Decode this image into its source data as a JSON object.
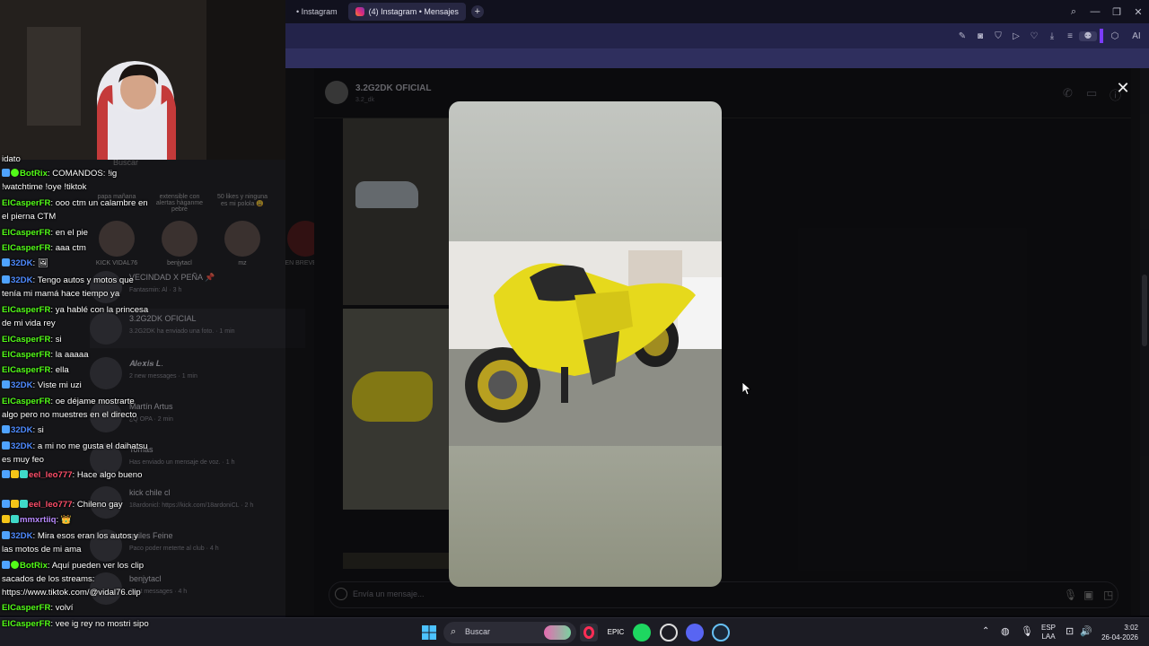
{
  "browser": {
    "tabs": [
      {
        "label": "• Instagram"
      },
      {
        "label": "(4) Instagram • Mensajes"
      }
    ],
    "new_tab": "+",
    "toolbar_ai": "AI"
  },
  "instagram": {
    "search_placeholder": "Buscar",
    "notes": [
      {
        "text": "",
        "name": "KICK VIDAL76"
      },
      {
        "text": "extensible con alertas hàganme pebre",
        "name": "benjytacl"
      },
      {
        "text": "50 likes y ninguna es mi polola 😩",
        "name": "mz"
      },
      {
        "text": "",
        "name": "EN BREVE MI"
      }
    ],
    "note_first_bubble": "papa mañana",
    "conversations": [
      {
        "title": "VECINDAD X PEÑA 📌",
        "sub": "Fantasmin: Al · 3 h"
      },
      {
        "title": "3.2G2DK OFICIAL",
        "sub": "3.2G2DK ha enviado una foto. · 1 min"
      },
      {
        "title": "𝑨𝒍𝒆𝒙𝒊𝒔 𝑳.",
        "sub": "2 new messages · 1 min"
      },
      {
        "title": "Martín Artus",
        "sub": "¿Q OPA · 2 min"
      },
      {
        "title": "Tomás",
        "sub": "Has enviado un mensaje de voz. · 1 h"
      },
      {
        "title": "kick chile cl",
        "sub": "18ardonicl: https://kick.com/18ardoniCL · 2 h"
      },
      {
        "title": "quiles Feine",
        "sub": "Paco poder meterte al club · 4 h"
      },
      {
        "title": "benjytacl",
        "sub": "Sent messages · 4 h"
      }
    ],
    "thread": {
      "name": "3.2G2DK OFICIAL",
      "username": "3.2_dk",
      "message_placeholder": "Envía un mensaje..."
    }
  },
  "chat": [
    {
      "pre": "",
      "user": "",
      "text": "idato",
      "color": "#ffffff"
    },
    {
      "pre": "✓",
      "user": "BotRix",
      "text": ": COMANDOS: !ig !watchtime !oye !tiktok",
      "color": "#53fc18"
    },
    {
      "pre": "",
      "user": "ElCasperFR",
      "text": ": ooo ctm un calambre en el pierna CTM",
      "color": "#53fc18"
    },
    {
      "pre": "",
      "user": "ElCasperFR",
      "text": ": en el pie",
      "color": "#53fc18"
    },
    {
      "pre": "",
      "user": "ElCasperFR",
      "text": ": aaa ctm",
      "color": "#53fc18"
    },
    {
      "pre": "",
      "user": "32DK",
      "text": ": 🖼",
      "color": "#4f8bff"
    },
    {
      "pre": "",
      "user": "32DK",
      "text": ": Tengo autos y motos que tenía mi mamá hace tiempo ya",
      "color": "#4f8bff"
    },
    {
      "pre": "",
      "user": "ElCasperFR",
      "text": ": ya hablé con la princesa de mi vida rey",
      "color": "#53fc18"
    },
    {
      "pre": "",
      "user": "ElCasperFR",
      "text": ": si",
      "color": "#53fc18"
    },
    {
      "pre": "",
      "user": "ElCasperFR",
      "text": ": la aaaaa",
      "color": "#53fc18"
    },
    {
      "pre": "",
      "user": "ElCasperFR",
      "text": ": ella",
      "color": "#53fc18"
    },
    {
      "pre": "",
      "user": "32DK",
      "text": ": Viste mi uzi",
      "color": "#4f8bff"
    },
    {
      "pre": "",
      "user": "ElCasperFR",
      "text": ": oe déjame mostrarte algo pero no muestres en el directo",
      "color": "#53fc18"
    },
    {
      "pre": "",
      "user": "32DK",
      "text": ": si",
      "color": "#4f8bff"
    },
    {
      "pre": "",
      "user": "32DK",
      "text": ": a mi no me gusta el daihatsu es muy feo",
      "color": "#4f8bff"
    },
    {
      "pre": "",
      "user": "eel_leo777",
      "text": ": Hace algo bueno",
      "color": "#ff4f6a"
    },
    {
      "pre": "",
      "user": "eel_leo777",
      "text": ": Chileno gay",
      "color": "#ff4f6a"
    },
    {
      "pre": "",
      "user": "mmxrtiiq",
      "text": ": 👑",
      "color": "#b98aff"
    },
    {
      "pre": "",
      "user": "32DK",
      "text": ": Mira esos eran los autos y las motos de mi ama",
      "color": "#4f8bff"
    },
    {
      "pre": "✓",
      "user": "BotRix",
      "text": ": Aquí pueden ver los clip sacados de los streams: https://www.tiktok.com/@vidal76.clip",
      "color": "#53fc18"
    },
    {
      "pre": "",
      "user": "ElCasperFR",
      "text": ": volví",
      "color": "#53fc18"
    },
    {
      "pre": "",
      "user": "ElCasperFR",
      "text": ": vee ig rey no mostri sipo",
      "color": "#53fc18"
    }
  ],
  "taskbar": {
    "search_label": "Buscar",
    "lang_top": "ESP",
    "lang_bottom": "LAA",
    "time": "3:02",
    "date": "26-04-2026"
  },
  "colors": {
    "accent": "#7b3cff",
    "kick_green": "#53fc18",
    "instagram_bg": "#121215"
  }
}
